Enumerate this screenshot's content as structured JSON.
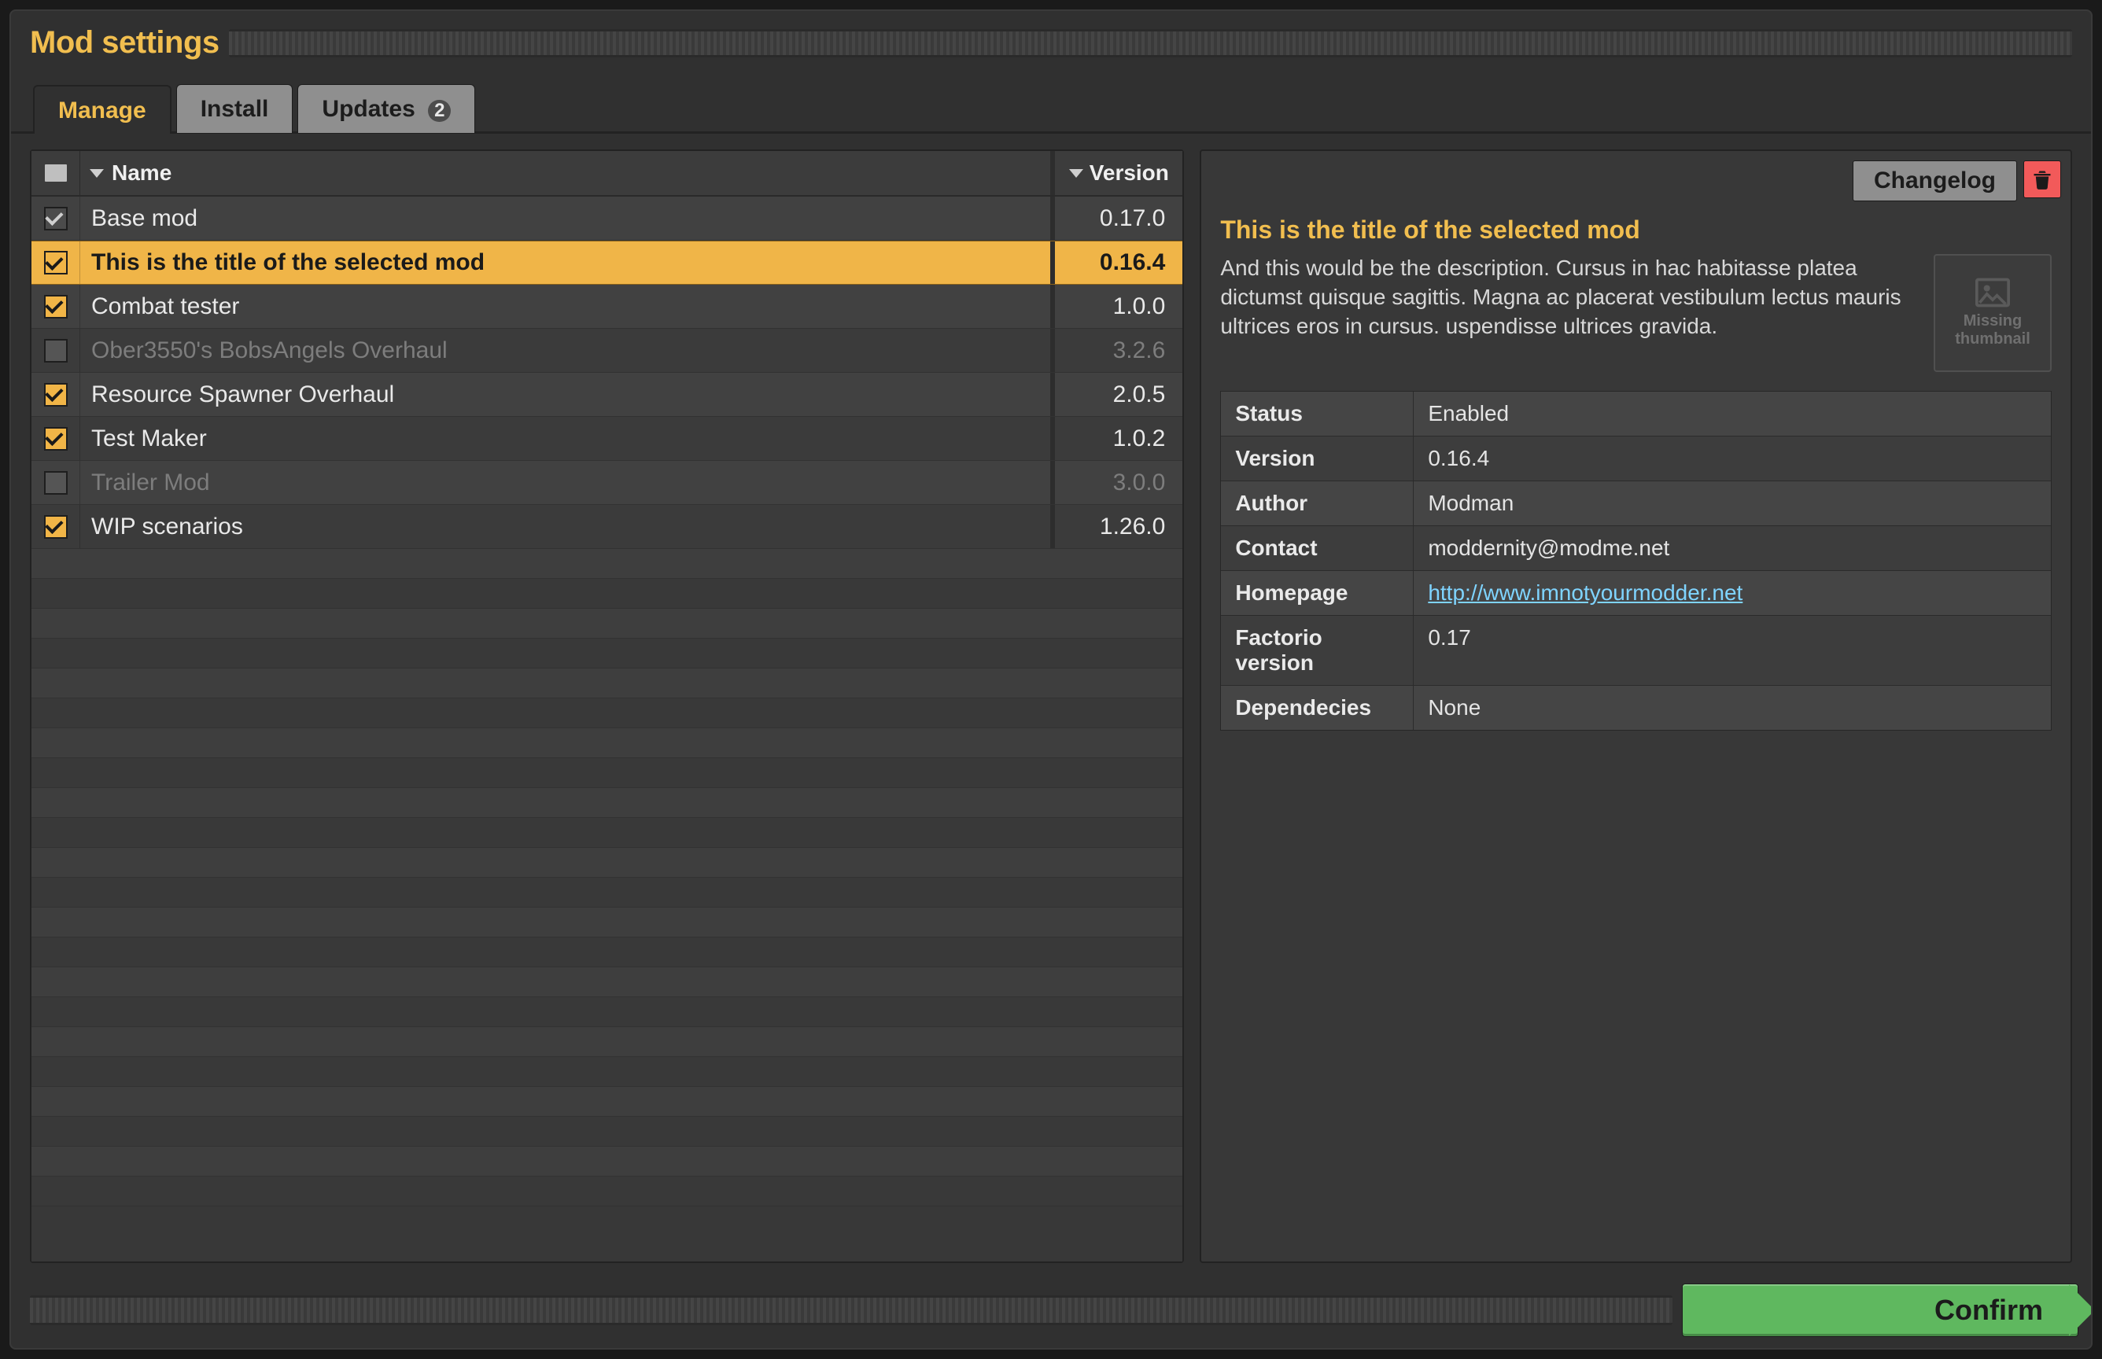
{
  "window": {
    "title": "Mod settings"
  },
  "tabs": {
    "manage": "Manage",
    "install": "Install",
    "updates": "Updates",
    "updates_count": "2",
    "active": "manage"
  },
  "list_header": {
    "name": "Name",
    "version": "Version"
  },
  "mods": [
    {
      "name": "Base mod",
      "version": "0.17.0",
      "state": "always",
      "selected": false
    },
    {
      "name": "This is the title of the selected mod",
      "version": "0.16.4",
      "state": "on",
      "selected": true
    },
    {
      "name": "Combat tester",
      "version": "1.0.0",
      "state": "on",
      "selected": false
    },
    {
      "name": "Ober3550's BobsAngels Overhaul",
      "version": "3.2.6",
      "state": "off",
      "selected": false
    },
    {
      "name": "Resource Spawner Overhaul",
      "version": "2.0.5",
      "state": "on",
      "selected": false
    },
    {
      "name": "Test Maker",
      "version": "1.0.2",
      "state": "on",
      "selected": false
    },
    {
      "name": "Trailer Mod",
      "version": "3.0.0",
      "state": "off",
      "selected": false
    },
    {
      "name": "WIP scenarios",
      "version": "1.26.0",
      "state": "on",
      "selected": false
    }
  ],
  "detail": {
    "changelog_button": "Changelog",
    "title": "This is the title of the selected mod",
    "description": "And this would be the description. Cursus in hac habitasse platea dictumst quisque sagittis. Magna ac placerat vestibulum lectus mauris ultrices eros in cursus. uspendisse ultrices gravida.",
    "thumbnail_missing": "Missing thumbnail",
    "labels": {
      "status": "Status",
      "version": "Version",
      "author": "Author",
      "contact": "Contact",
      "homepage": "Homepage",
      "factorio_version": "Factorio version",
      "dependencies": "Dependecies"
    },
    "values": {
      "status": "Enabled",
      "version": "0.16.4",
      "author": "Modman",
      "contact": "moddernity@modme.net",
      "homepage": "http://www.imnotyourmodder.net",
      "factorio_version": "0.17",
      "dependencies": "None"
    }
  },
  "footer": {
    "confirm": "Confirm"
  }
}
